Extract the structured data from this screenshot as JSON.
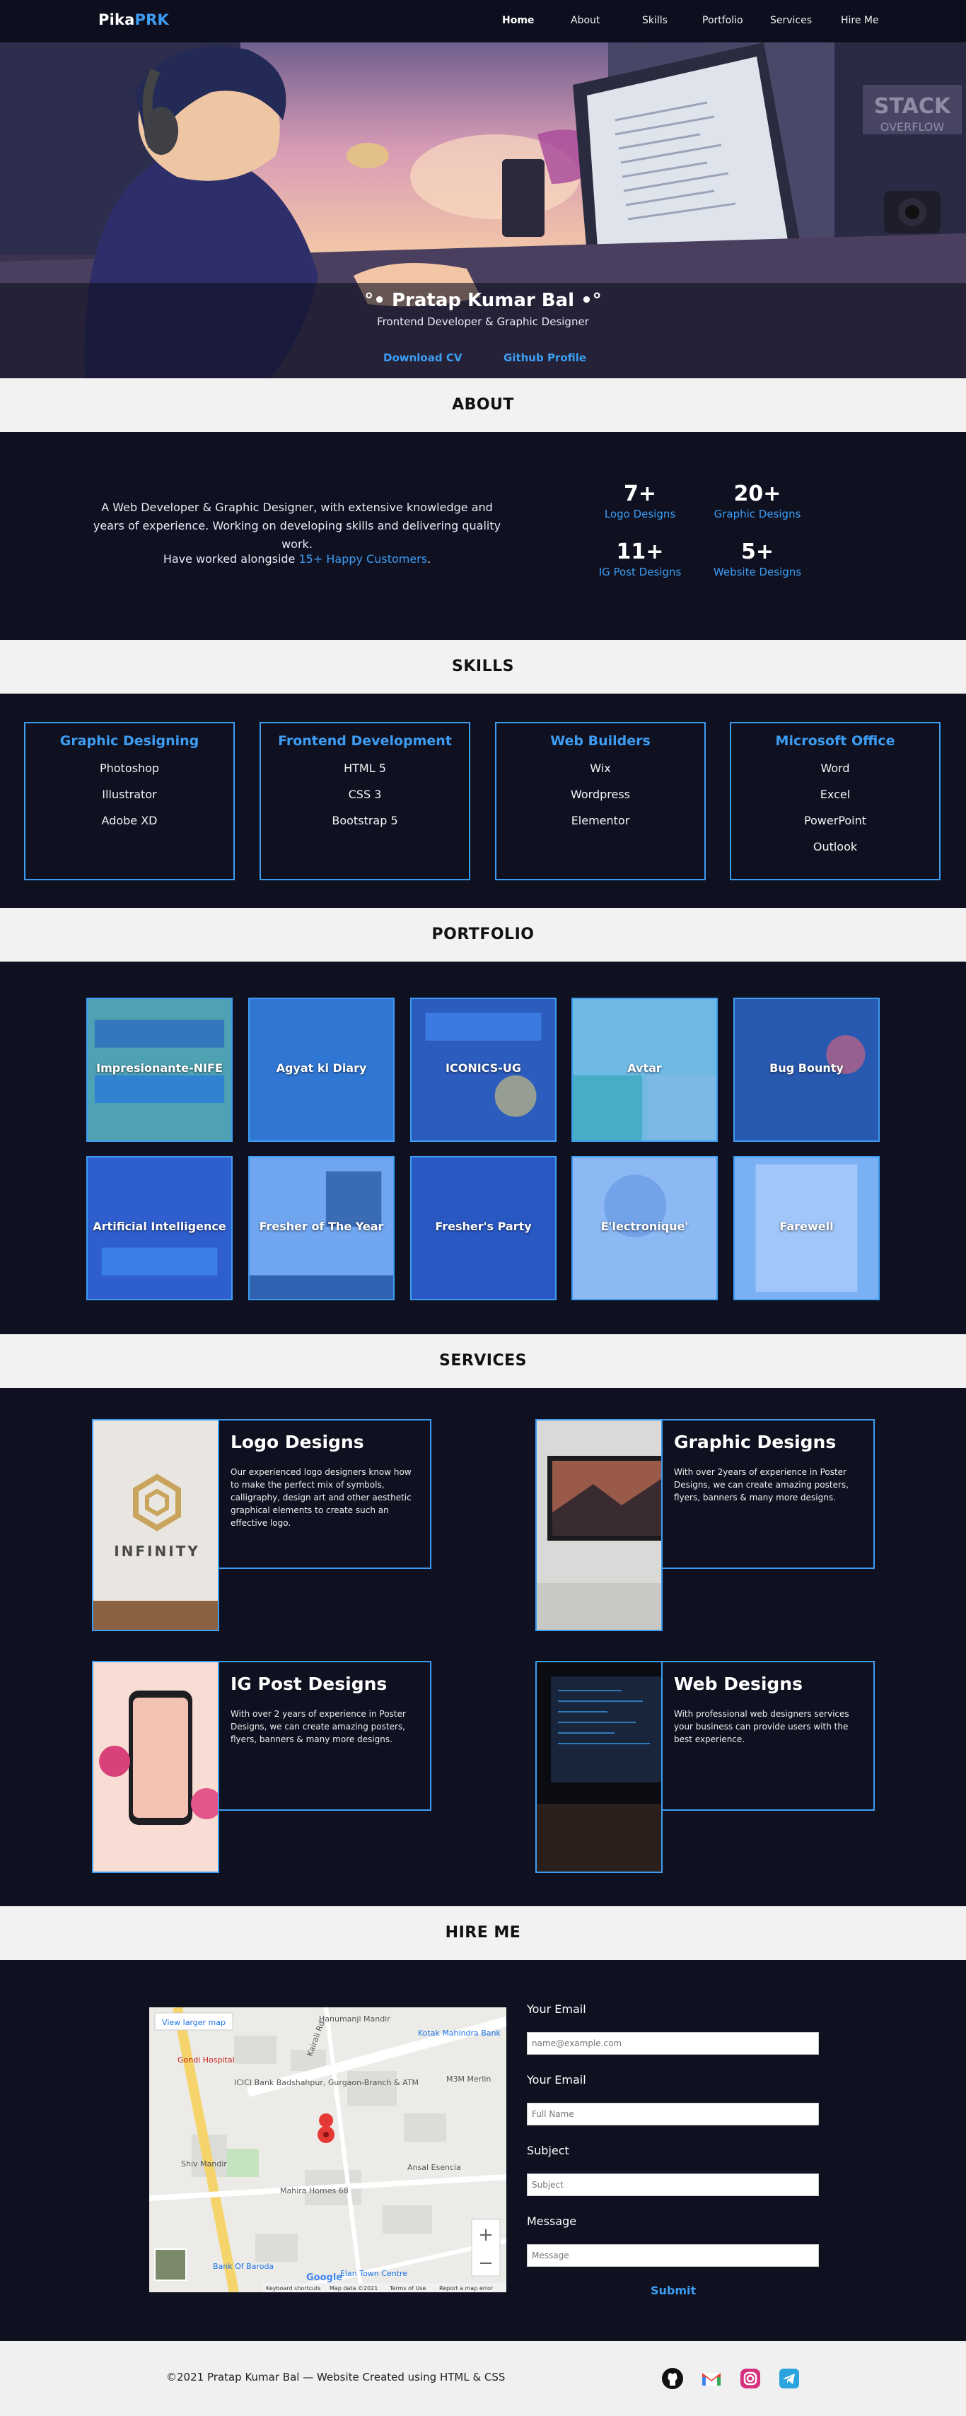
{
  "nav": {
    "logo_a": "Pika",
    "logo_b": "PRK",
    "links": [
      "Home",
      "About",
      "Skills",
      "Portfolio",
      "Services",
      "Hire Me"
    ]
  },
  "hero": {
    "name": "°• Pratap Kumar Bal •°",
    "subtitle": "Frontend Developer & Graphic Designer",
    "btn_cv": "Download CV",
    "btn_github": "Github Profile",
    "sign_text_1": "STACK",
    "sign_text_2": "OVERFLOW"
  },
  "about": {
    "title": "ABOUT",
    "text": "A Web Developer & Graphic Designer, with extensive knowledge and years of experience. Working on developing skills and delivering quality work.",
    "worked_prefix": "Have worked alongside ",
    "worked_highlight": "15+ Happy Customers",
    "worked_suffix": ".",
    "stats": [
      {
        "num": "7+",
        "label": "Logo Designs"
      },
      {
        "num": "20+",
        "label": "Graphic Designs"
      },
      {
        "num": "11+",
        "label": "IG Post Designs"
      },
      {
        "num": "5+",
        "label": "Website Designs"
      }
    ]
  },
  "skills": {
    "title": "SKILLS",
    "cards": [
      {
        "title": "Graphic Designing",
        "items": [
          "Photoshop",
          "Illustrator",
          "Adobe XD"
        ]
      },
      {
        "title": "Frontend Development",
        "items": [
          "HTML 5",
          "CSS 3",
          "Bootstrap 5"
        ]
      },
      {
        "title": "Web Builders",
        "items": [
          "Wix",
          "Wordpress",
          "Elementor"
        ]
      },
      {
        "title": "Microsoft Office",
        "items": [
          "Word",
          "Excel",
          "PowerPoint",
          "Outlook"
        ]
      }
    ]
  },
  "portfolio": {
    "title": "PORTFOLIO",
    "items": [
      "Impresionante-NIFE",
      "Agyat ki Diary",
      "ICONICS-UG",
      "Avtar",
      "Bug Bounty",
      "Artificial Intelligence",
      "Fresher of The Year",
      "Fresher's Party",
      "E'lectronique'",
      "Farewell"
    ]
  },
  "services": {
    "title": "SERVICES",
    "items": [
      {
        "title": "Logo Designs",
        "text": "Our experienced logo designers know how to make the perfect mix of symbols, calligraphy, design art and other aesthetic graphical elements to create such an effective logo."
      },
      {
        "title": "Graphic Designs",
        "text": "With over 2years of experience in Poster Designs, we can create amazing posters, flyers, banners & many more designs."
      },
      {
        "title": "IG Post Designs",
        "text": "With over 2 years of experience in Poster Designs, we can create amazing posters, flyers, banners & many more designs."
      },
      {
        "title": "Web Designs",
        "text": "With professional web designers services your business can provide users with the best experience."
      }
    ],
    "logo_art_text": "INFINITY"
  },
  "hire": {
    "title": "HIRE ME",
    "map": {
      "larger_map": "View larger map",
      "labels": [
        "Hanumanji Mandir",
        "Kotak Mahindra Bank",
        "Gondi Hospital",
        "ICICI Bank Badshahpur, Gurgaon-Branch & ATM",
        "M3M Merlin",
        "Shiv Mandir",
        "Mahira Homes 68",
        "Ansal Esencia",
        "Bank Of Baroda",
        "Elan Town Centre",
        "Kairali Rd"
      ],
      "footer": [
        "Keyboard shortcuts",
        "Map data ©2021",
        "Terms of Use",
        "Report a map error"
      ],
      "brand": "Google"
    },
    "fields": [
      {
        "label": "Your Email",
        "placeholder": "name@example.com"
      },
      {
        "label": "Your Email",
        "placeholder": "Full Name"
      },
      {
        "label": "Subject",
        "placeholder": "Subject"
      },
      {
        "label": "Message",
        "placeholder": "Message"
      }
    ],
    "submit": "Submit"
  },
  "footer": {
    "copyright": "©2021 Pratap Kumar Bal — Website Created using HTML & CSS",
    "icons": [
      "github-icon",
      "gmail-icon",
      "instagram-icon",
      "telegram-icon"
    ]
  }
}
